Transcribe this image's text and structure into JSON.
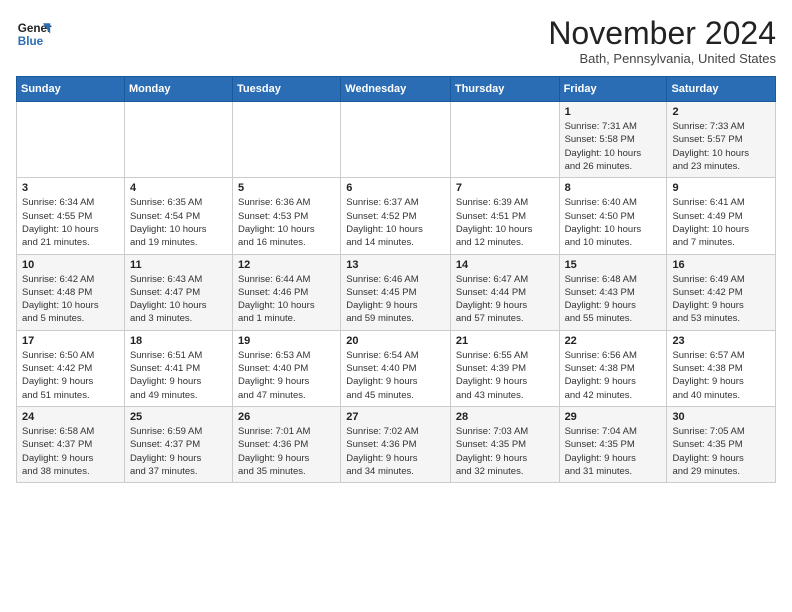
{
  "logo": {
    "line1": "General",
    "line2": "Blue"
  },
  "title": "November 2024",
  "location": "Bath, Pennsylvania, United States",
  "days_of_week": [
    "Sunday",
    "Monday",
    "Tuesday",
    "Wednesday",
    "Thursday",
    "Friday",
    "Saturday"
  ],
  "weeks": [
    [
      {
        "day": "",
        "info": ""
      },
      {
        "day": "",
        "info": ""
      },
      {
        "day": "",
        "info": ""
      },
      {
        "day": "",
        "info": ""
      },
      {
        "day": "",
        "info": ""
      },
      {
        "day": "1",
        "info": "Sunrise: 7:31 AM\nSunset: 5:58 PM\nDaylight: 10 hours\nand 26 minutes."
      },
      {
        "day": "2",
        "info": "Sunrise: 7:33 AM\nSunset: 5:57 PM\nDaylight: 10 hours\nand 23 minutes."
      }
    ],
    [
      {
        "day": "3",
        "info": "Sunrise: 6:34 AM\nSunset: 4:55 PM\nDaylight: 10 hours\nand 21 minutes."
      },
      {
        "day": "4",
        "info": "Sunrise: 6:35 AM\nSunset: 4:54 PM\nDaylight: 10 hours\nand 19 minutes."
      },
      {
        "day": "5",
        "info": "Sunrise: 6:36 AM\nSunset: 4:53 PM\nDaylight: 10 hours\nand 16 minutes."
      },
      {
        "day": "6",
        "info": "Sunrise: 6:37 AM\nSunset: 4:52 PM\nDaylight: 10 hours\nand 14 minutes."
      },
      {
        "day": "7",
        "info": "Sunrise: 6:39 AM\nSunset: 4:51 PM\nDaylight: 10 hours\nand 12 minutes."
      },
      {
        "day": "8",
        "info": "Sunrise: 6:40 AM\nSunset: 4:50 PM\nDaylight: 10 hours\nand 10 minutes."
      },
      {
        "day": "9",
        "info": "Sunrise: 6:41 AM\nSunset: 4:49 PM\nDaylight: 10 hours\nand 7 minutes."
      }
    ],
    [
      {
        "day": "10",
        "info": "Sunrise: 6:42 AM\nSunset: 4:48 PM\nDaylight: 10 hours\nand 5 minutes."
      },
      {
        "day": "11",
        "info": "Sunrise: 6:43 AM\nSunset: 4:47 PM\nDaylight: 10 hours\nand 3 minutes."
      },
      {
        "day": "12",
        "info": "Sunrise: 6:44 AM\nSunset: 4:46 PM\nDaylight: 10 hours\nand 1 minute."
      },
      {
        "day": "13",
        "info": "Sunrise: 6:46 AM\nSunset: 4:45 PM\nDaylight: 9 hours\nand 59 minutes."
      },
      {
        "day": "14",
        "info": "Sunrise: 6:47 AM\nSunset: 4:44 PM\nDaylight: 9 hours\nand 57 minutes."
      },
      {
        "day": "15",
        "info": "Sunrise: 6:48 AM\nSunset: 4:43 PM\nDaylight: 9 hours\nand 55 minutes."
      },
      {
        "day": "16",
        "info": "Sunrise: 6:49 AM\nSunset: 4:42 PM\nDaylight: 9 hours\nand 53 minutes."
      }
    ],
    [
      {
        "day": "17",
        "info": "Sunrise: 6:50 AM\nSunset: 4:42 PM\nDaylight: 9 hours\nand 51 minutes."
      },
      {
        "day": "18",
        "info": "Sunrise: 6:51 AM\nSunset: 4:41 PM\nDaylight: 9 hours\nand 49 minutes."
      },
      {
        "day": "19",
        "info": "Sunrise: 6:53 AM\nSunset: 4:40 PM\nDaylight: 9 hours\nand 47 minutes."
      },
      {
        "day": "20",
        "info": "Sunrise: 6:54 AM\nSunset: 4:40 PM\nDaylight: 9 hours\nand 45 minutes."
      },
      {
        "day": "21",
        "info": "Sunrise: 6:55 AM\nSunset: 4:39 PM\nDaylight: 9 hours\nand 43 minutes."
      },
      {
        "day": "22",
        "info": "Sunrise: 6:56 AM\nSunset: 4:38 PM\nDaylight: 9 hours\nand 42 minutes."
      },
      {
        "day": "23",
        "info": "Sunrise: 6:57 AM\nSunset: 4:38 PM\nDaylight: 9 hours\nand 40 minutes."
      }
    ],
    [
      {
        "day": "24",
        "info": "Sunrise: 6:58 AM\nSunset: 4:37 PM\nDaylight: 9 hours\nand 38 minutes."
      },
      {
        "day": "25",
        "info": "Sunrise: 6:59 AM\nSunset: 4:37 PM\nDaylight: 9 hours\nand 37 minutes."
      },
      {
        "day": "26",
        "info": "Sunrise: 7:01 AM\nSunset: 4:36 PM\nDaylight: 9 hours\nand 35 minutes."
      },
      {
        "day": "27",
        "info": "Sunrise: 7:02 AM\nSunset: 4:36 PM\nDaylight: 9 hours\nand 34 minutes."
      },
      {
        "day": "28",
        "info": "Sunrise: 7:03 AM\nSunset: 4:35 PM\nDaylight: 9 hours\nand 32 minutes."
      },
      {
        "day": "29",
        "info": "Sunrise: 7:04 AM\nSunset: 4:35 PM\nDaylight: 9 hours\nand 31 minutes."
      },
      {
        "day": "30",
        "info": "Sunrise: 7:05 AM\nSunset: 4:35 PM\nDaylight: 9 hours\nand 29 minutes."
      }
    ]
  ]
}
